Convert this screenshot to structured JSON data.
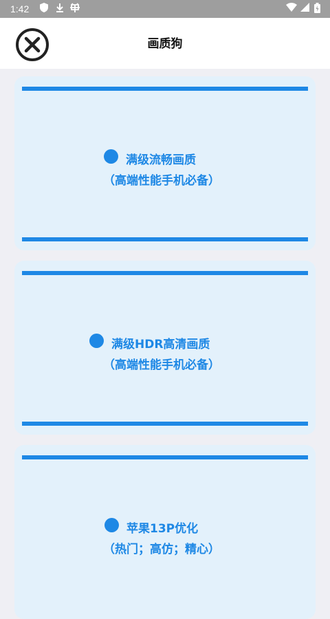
{
  "status_bar": {
    "time": "1:42",
    "icons": [
      "shield-icon",
      "download-icon",
      "bug-icon",
      "wifi-icon",
      "cell-signal-icon",
      "battery-icon"
    ]
  },
  "header": {
    "title": "画质狗",
    "close_icon": "close-circle-icon"
  },
  "options": [
    {
      "line1": "满级流畅画质",
      "line2": "（高端性能手机必备）"
    },
    {
      "line1": "满级HDR高清画质",
      "line2": "（高端性能手机必备）"
    },
    {
      "line1": "苹果13P优化",
      "line2": "（热门；高仿；精心）"
    }
  ],
  "colors": {
    "accent": "#1e88e5",
    "card_bg": "#e3f1fb",
    "page_bg": "#efeff4",
    "status_bar": "#9e9e9e"
  }
}
